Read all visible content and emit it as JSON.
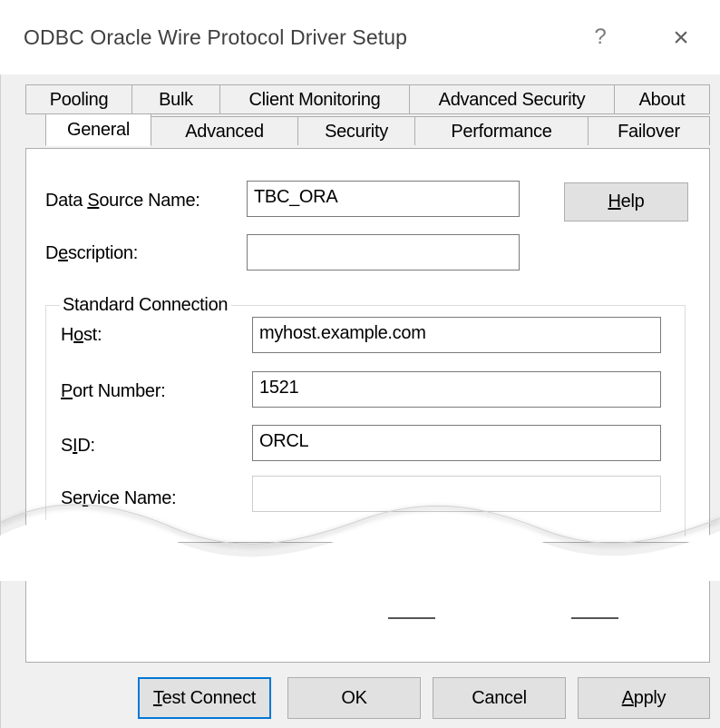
{
  "window": {
    "title": "ODBC Oracle Wire Protocol Driver Setup",
    "help_glyph": "?",
    "close_glyph": "×"
  },
  "tabs": {
    "back_row": [
      "Pooling",
      "Bulk",
      "Client Monitoring",
      "Advanced Security",
      "About"
    ],
    "front_row": [
      "General",
      "Advanced",
      "Security",
      "Performance",
      "Failover"
    ],
    "selected": "General"
  },
  "general": {
    "dsn_label_pre": "Data ",
    "dsn_label_u": "S",
    "dsn_label_post": "ource Name:",
    "dsn_value": "TBC_ORA",
    "desc_label_pre": "D",
    "desc_label_u": "e",
    "desc_label_post": "scription:",
    "desc_value": "",
    "help_button_u": "H",
    "help_button_post": "elp"
  },
  "standard_connection": {
    "group_title": "Standard Connection",
    "host_label_pre": "H",
    "host_label_u": "o",
    "host_label_post": "st:",
    "host_value": "myhost.example.com",
    "port_label_u": "P",
    "port_label_post": "ort Number:",
    "port_value": "1521",
    "sid_label_pre": "S",
    "sid_label_u": "I",
    "sid_label_post": "D:",
    "sid_value": "ORCL",
    "service_label_pre": "Se",
    "service_label_u": "r",
    "service_label_post": "vice Name:",
    "service_value": ""
  },
  "footer": {
    "test_connect_u": "T",
    "test_connect_post": "est Connect",
    "ok": "OK",
    "cancel": "Cancel",
    "apply_u": "A",
    "apply_post": "pply"
  },
  "colors": {
    "focus_border": "#0078d7",
    "dialog_bg": "#f0f0f0",
    "panel_bg": "#ffffff"
  }
}
